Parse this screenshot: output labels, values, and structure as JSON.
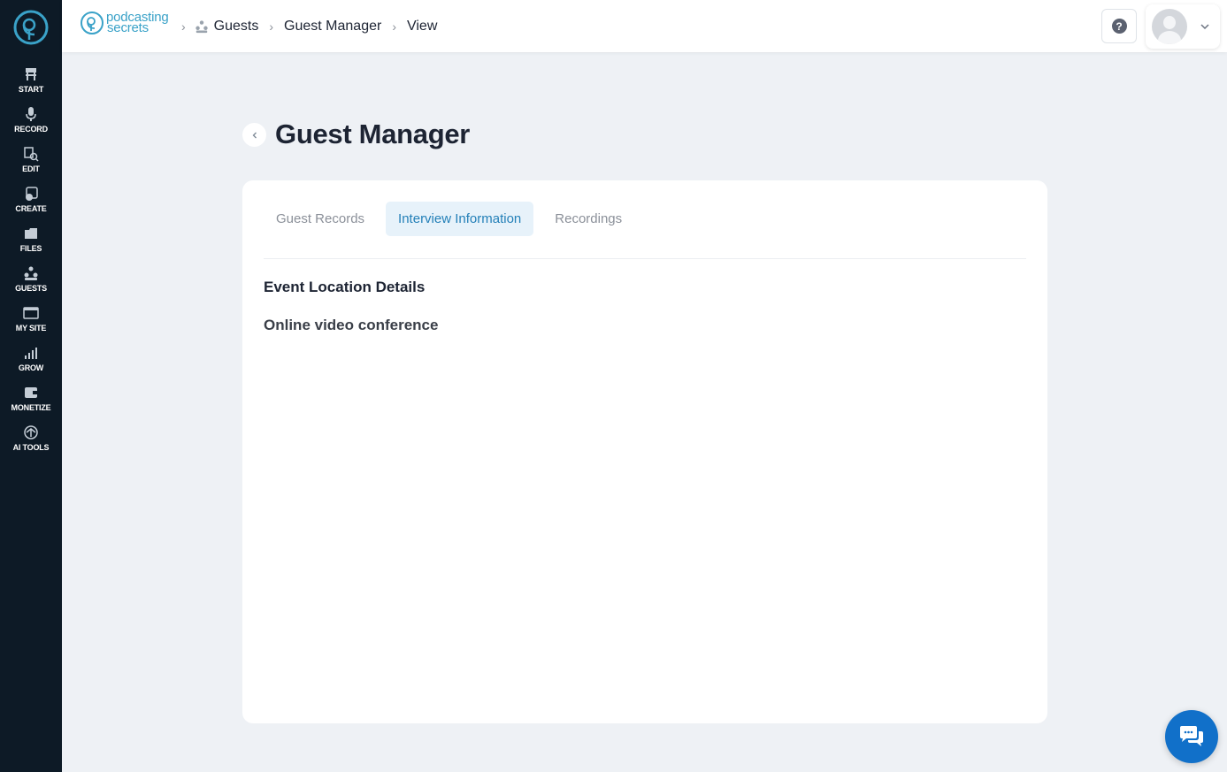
{
  "sidebar": {
    "items": [
      {
        "label": "START",
        "icon": "start-icon"
      },
      {
        "label": "RECORD",
        "icon": "microphone-icon"
      },
      {
        "label": "EDIT",
        "icon": "edit-icon"
      },
      {
        "label": "CREATE",
        "icon": "create-icon"
      },
      {
        "label": "FILES",
        "icon": "files-icon"
      },
      {
        "label": "GUESTS",
        "icon": "guests-icon"
      },
      {
        "label": "MY SITE",
        "icon": "site-icon"
      },
      {
        "label": "GROW",
        "icon": "chart-icon"
      },
      {
        "label": "MONETIZE",
        "icon": "monetize-icon"
      },
      {
        "label": "AI TOOLS",
        "icon": "ai-tools-icon"
      }
    ]
  },
  "header": {
    "brand_line1": "podcasting",
    "brand_line2": "secrets",
    "breadcrumb": [
      "Guests",
      "Guest Manager",
      "View"
    ]
  },
  "main": {
    "title": "Guest Manager",
    "tabs": [
      {
        "label": "Guest Records",
        "active": false
      },
      {
        "label": "Interview Information",
        "active": true
      },
      {
        "label": "Recordings",
        "active": false
      }
    ],
    "section_title": "Event Location Details",
    "section_value": "Online video conference"
  },
  "colors": {
    "sidebar_bg": "#0d1a26",
    "accent": "#2480b8",
    "brand": "#3aa2c8",
    "chat_button": "#1170c9"
  }
}
